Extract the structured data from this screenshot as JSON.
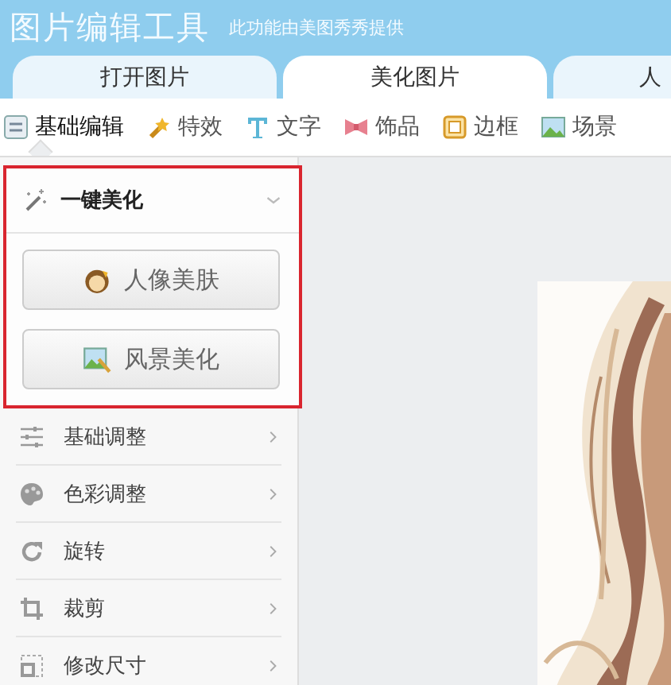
{
  "header": {
    "title": "图片编辑工具",
    "subtitle": "此功能由美图秀秀提供"
  },
  "tabs": [
    {
      "label": "打开图片",
      "selected": false
    },
    {
      "label": "美化图片",
      "selected": true
    },
    {
      "label": "人",
      "selected": false
    }
  ],
  "toolbar": [
    {
      "label": "基础编辑",
      "selected": true
    },
    {
      "label": "特效",
      "selected": false
    },
    {
      "label": "文字",
      "selected": false
    },
    {
      "label": "饰品",
      "selected": false
    },
    {
      "label": "边框",
      "selected": false
    },
    {
      "label": "场景",
      "selected": false
    }
  ],
  "sidebar": {
    "section": {
      "title": "一键美化",
      "expanded": true,
      "highlighted": true,
      "buttons": [
        "人像美肤",
        "风景美化"
      ]
    },
    "items": [
      "基础调整",
      "色彩调整",
      "旋转",
      "裁剪",
      "修改尺寸"
    ]
  }
}
